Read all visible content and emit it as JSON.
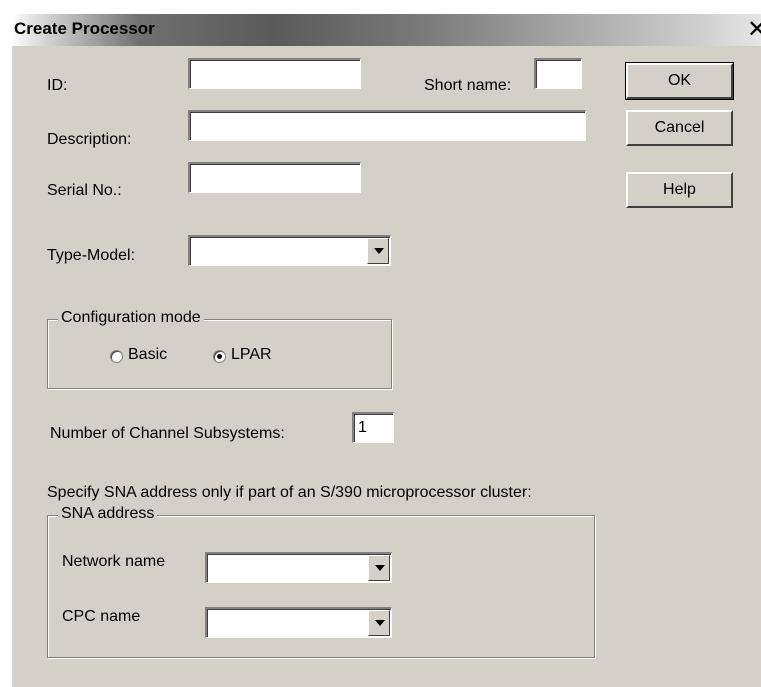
{
  "window": {
    "title": "Create Processor",
    "close_glyph": "✕"
  },
  "form": {
    "id_label": "ID:",
    "id_value": "",
    "short_name_label": "Short name:",
    "short_name_value": "",
    "description_label": "Description:",
    "description_value": "",
    "serial_label": "Serial No.:",
    "serial_value": "",
    "type_model_label": "Type-Model:",
    "type_model_value": ""
  },
  "buttons": {
    "ok": "OK",
    "cancel": "Cancel",
    "help": "Help"
  },
  "config_mode": {
    "legend": "Configuration mode",
    "options": [
      "Basic",
      "LPAR"
    ],
    "selected": "LPAR"
  },
  "channel": {
    "label": "Number of Channel Subsystems:",
    "value": "1"
  },
  "sna": {
    "note": "Specify SNA address only if part of an S/390 microprocessor cluster:",
    "legend": "SNA address",
    "network_label": "Network name",
    "network_value": "",
    "cpc_label": "CPC name",
    "cpc_value": ""
  }
}
